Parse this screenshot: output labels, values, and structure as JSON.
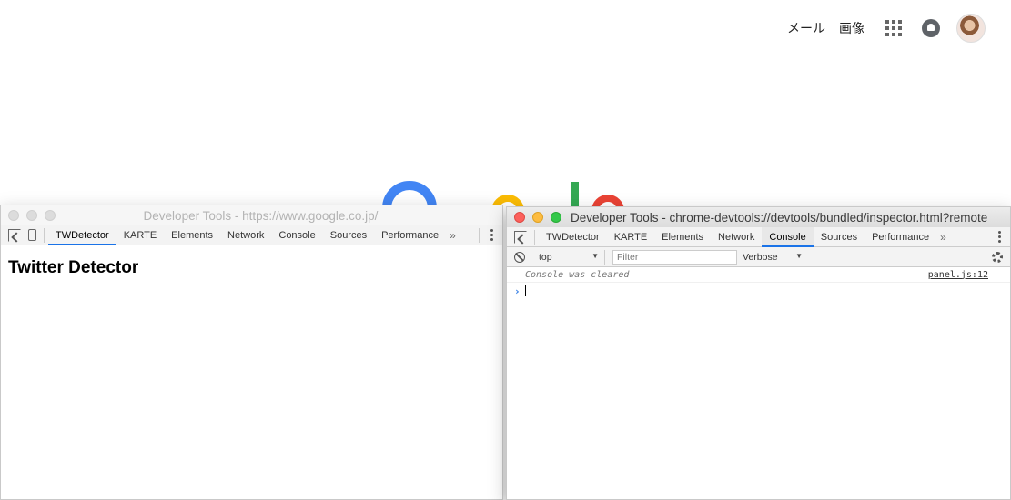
{
  "google": {
    "mail_link": "メール",
    "images_link": "画像"
  },
  "left_window": {
    "title": "Developer Tools - https://www.google.co.jp/",
    "tabs": [
      "TWDetector",
      "KARTE",
      "Elements",
      "Network",
      "Console",
      "Sources",
      "Performance"
    ],
    "active_tab": "TWDetector",
    "more": "»",
    "heading": "Twitter Detector"
  },
  "right_window": {
    "title": "Developer Tools - chrome-devtools://devtools/bundled/inspector.html?remote",
    "tabs": [
      "TWDetector",
      "KARTE",
      "Elements",
      "Network",
      "Console",
      "Sources",
      "Performance"
    ],
    "active_tab": "Console",
    "more": "»",
    "console": {
      "context": "top",
      "filter_placeholder": "Filter",
      "level": "Verbose",
      "message": "Console was cleared",
      "message_source": "panel.js:12",
      "prompt": "›"
    }
  },
  "colors": {
    "accent": "#1a73e8",
    "traffic_red": "#fc605c",
    "traffic_yellow": "#fdbc40",
    "traffic_green": "#34c84a"
  }
}
